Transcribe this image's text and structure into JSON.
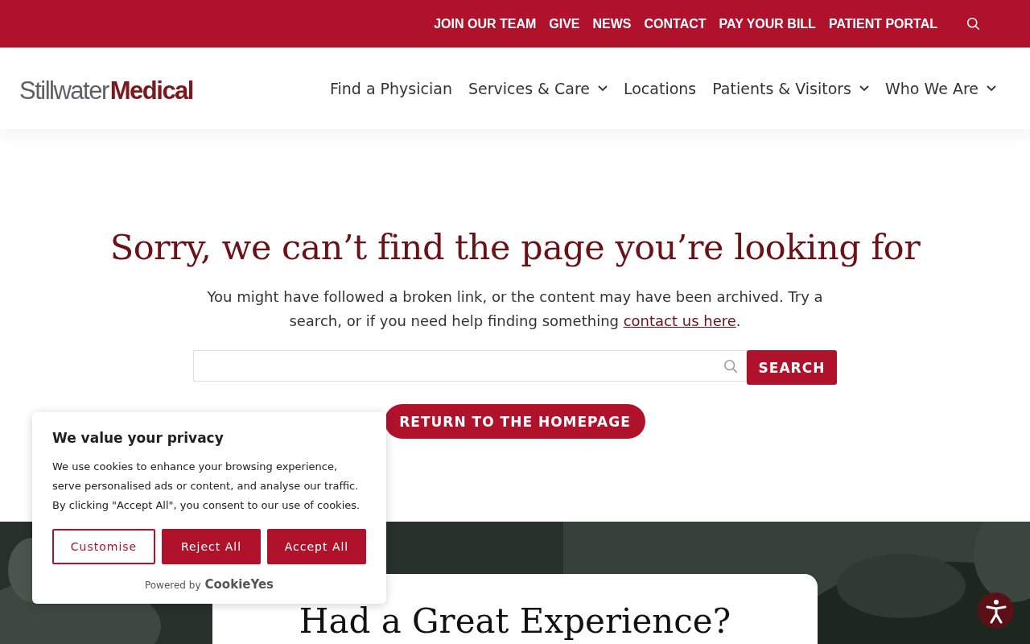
{
  "top_bar": {
    "links": [
      "JOIN OUR TEAM",
      "GIVE",
      "NEWS",
      "CONTACT",
      "PAY YOUR BILL",
      "PATIENT PORTAL"
    ]
  },
  "header": {
    "logo": {
      "light": "Stillwater",
      "bold": "Medical"
    },
    "nav": [
      {
        "label": "Find a Physician",
        "has_menu": false
      },
      {
        "label": "Services & Care",
        "has_menu": true
      },
      {
        "label": "Locations",
        "has_menu": false
      },
      {
        "label": "Patients & Visitors",
        "has_menu": true
      },
      {
        "label": "Who We Are",
        "has_menu": true
      }
    ]
  },
  "error": {
    "title": "Sorry, we can’t find the page you’re looking for",
    "text_before": "You might have followed a broken link, or the content may have been archived. Try a search, or if you need help finding something ",
    "link": "contact us here",
    "text_after": ".",
    "search_button": "SEARCH",
    "home_button": "RETURN TO THE HOMEPAGE"
  },
  "feedback": {
    "kind": "picture",
    "heading": "Had a Great Experience?"
  },
  "cookie_banner": {
    "title": "We value your privacy",
    "text": "We use cookies to enhance your browsing experience, serve personalised ads or content, and analyse our traffic. By clicking \"Accept All\", you consent to our use of cookies.",
    "buttons": [
      {
        "label": "Customise",
        "kind": "outline"
      },
      {
        "label": "Reject All",
        "kind": "filled"
      },
      {
        "label": "Accept All",
        "kind": "filled"
      }
    ],
    "powered_by": "Powered by",
    "brand": "CookieYes"
  }
}
